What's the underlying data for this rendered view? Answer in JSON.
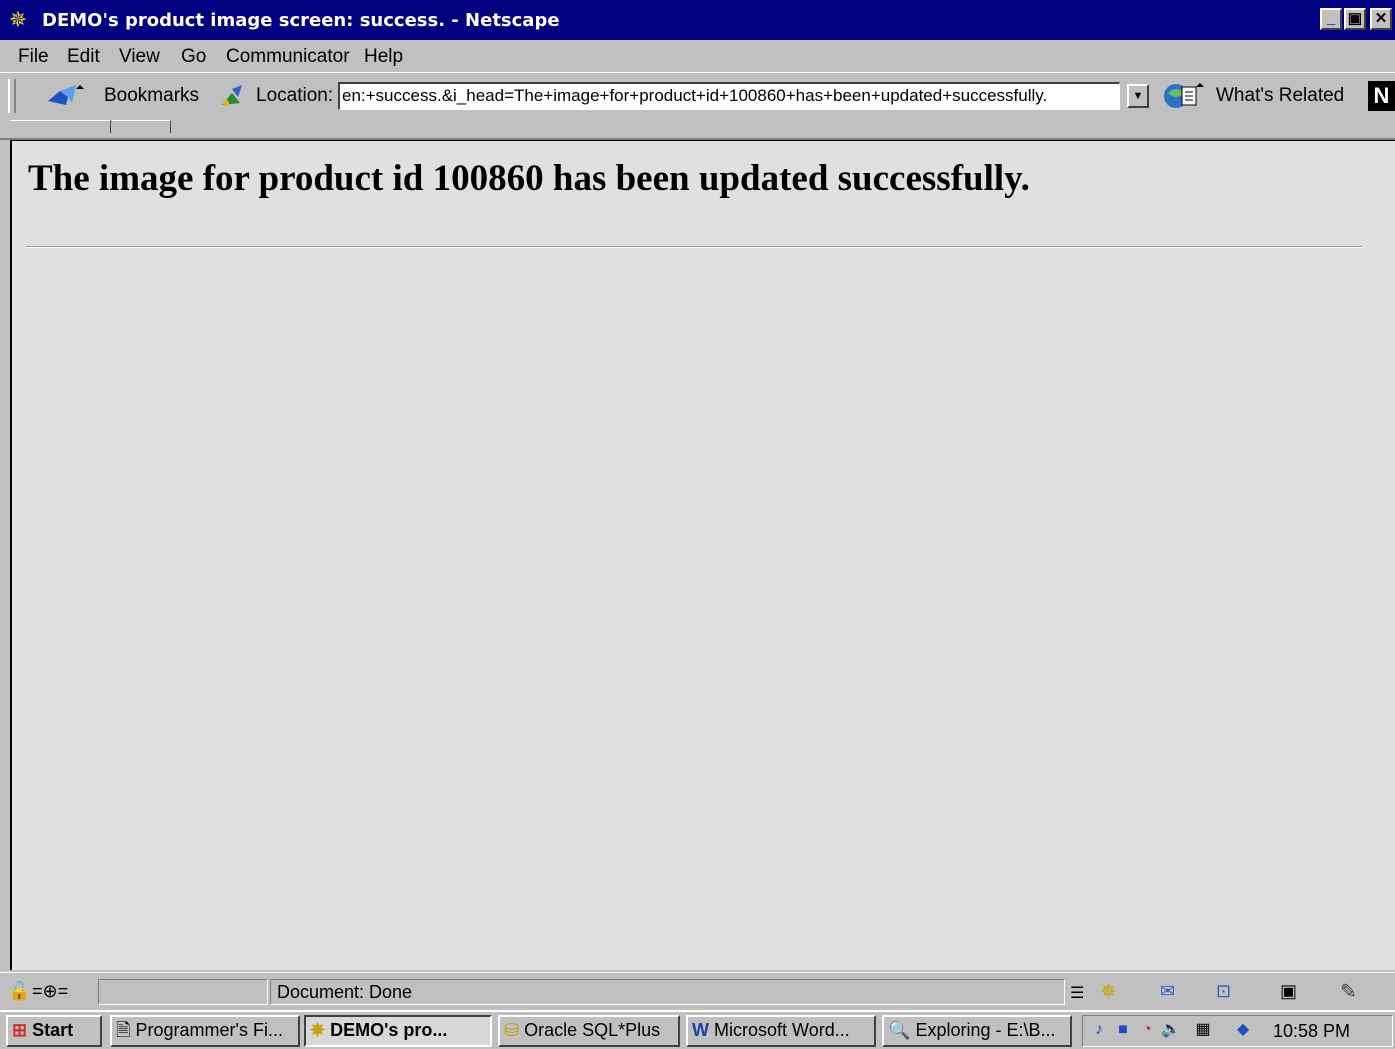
{
  "window": {
    "title": "DEMO's product image screen: success. - Netscape",
    "buttons": {
      "minimize": "_",
      "maximize": "□",
      "close": "✕"
    }
  },
  "menu": [
    "File",
    "Edit",
    "View",
    "Go",
    "Communicator",
    "Help"
  ],
  "toolbar": {
    "bookmarks_label": "Bookmarks",
    "location_label": "Location:",
    "url": "en:+success.&i_head=The+image+for+product+id+100860+has+been+updated+successfully.",
    "whats_related_label": "What's Related"
  },
  "page": {
    "heading": "The image for product id 100860 has been updated successfully."
  },
  "status": {
    "text": "Document: Done"
  },
  "taskbar": {
    "start_label": "Start",
    "tasks": [
      {
        "label": "Programmer's Fi..."
      },
      {
        "label": "DEMO's pro..."
      },
      {
        "label": "Oracle SQL*Plus"
      },
      {
        "label": "Microsoft Word..."
      },
      {
        "label": "Exploring - E:\\B..."
      }
    ],
    "clock": "10:58 PM"
  },
  "colors": {
    "title_bar": "#000080",
    "chrome": "#c0c0c0",
    "content_bg": "#e0e0e0"
  }
}
